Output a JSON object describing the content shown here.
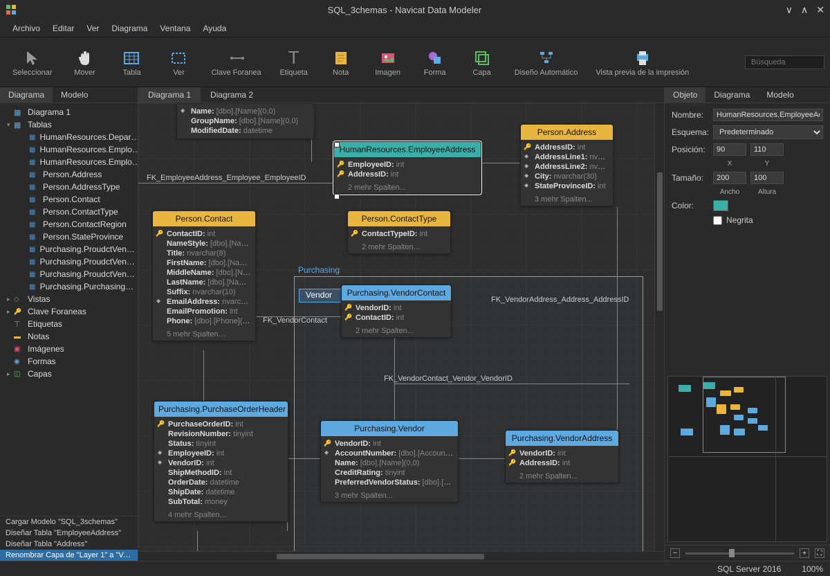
{
  "titlebar": {
    "title": "SQL_3chemas - Navicat Data Modeler"
  },
  "menubar": [
    "Archivo",
    "Editar",
    "Ver",
    "Diagrama",
    "Ventana",
    "Ayuda"
  ],
  "toolbar": {
    "items": [
      "Seleccionar",
      "Mover",
      "Tabla",
      "Ver",
      "Clave Foranea",
      "Etiqueta",
      "Nota",
      "Imagen",
      "Forma",
      "Capa",
      "Diseño Automático",
      "Vista previa de la impresión"
    ],
    "search_placeholder": "Búsqueda"
  },
  "left_tabs": {
    "diagrama": "Diagrama",
    "modelo": "Modelo"
  },
  "tree": {
    "diagram": "Diagrama 1",
    "tables_label": "Tablas",
    "tables": [
      "HumanResources.Depar…",
      "HumanResources.Emplo…",
      "HumanResources.Emplo…",
      "Person.Address",
      "Person.AddressType",
      "Person.Contact",
      "Person.ContactType",
      "Person.ContactRegion",
      "Person.StateProvince",
      "Purchasing.ProudctVen…",
      "Purchasing.ProudctVen…",
      "Purchasing.ProudctVen…",
      "Purchasing.Purchasing…"
    ],
    "vistas": "Vistas",
    "clave": "Clave Foraneas",
    "etiquetas": "Etiquetas",
    "notas": "Notas",
    "imagenes": "Imágenes",
    "formas": "Formas",
    "capas": "Capas"
  },
  "history": [
    "Cargar Modelo \"SQL_3schemas\"",
    "Diseñar Tabla \"EmployeeAddress\"",
    "Diseñar Tabla \"Address\"",
    "Renombrar Capa de \"Layer 1\" a \"Ve…"
  ],
  "canvas_tabs": [
    "Diagrama 1",
    "Diagrama 2"
  ],
  "layers": {
    "purchasing": "Purchasing",
    "vendor": "Vendor"
  },
  "fk_labels": {
    "emp": "FK_EmployeeAddress_Employee_EmployeeID",
    "vc": "FK_VendorContact",
    "vv": "FK_VendorContact_Vendor_VendorID",
    "va": "FK_VendorAddress_Address_AddressID"
  },
  "entities": {
    "empdept": {
      "title": "",
      "rows": [
        {
          "k": "di",
          "n": "Name:",
          "t": "[dbo].[Name](0,0)"
        },
        {
          "k": "",
          "n": "GroupName:",
          "t": "[dbo].[Name](0,0)"
        },
        {
          "k": "",
          "n": "ModifiedDate:",
          "t": "datetime"
        }
      ]
    },
    "empaddr": {
      "title": "HumanResources.EmployeeAddress",
      "rows": [
        {
          "k": "pk",
          "n": "EmployeeID:",
          "t": "int"
        },
        {
          "k": "pk",
          "n": "AddressID:",
          "t": "int"
        }
      ],
      "more": "2 mehr Spalten..."
    },
    "paddr": {
      "title": "Person.Address",
      "rows": [
        {
          "k": "pk",
          "n": "AddressID:",
          "t": "int"
        },
        {
          "k": "di",
          "n": "AddressLine1:",
          "t": "nvarchar(…"
        },
        {
          "k": "di",
          "n": "AddressLine2:",
          "t": "nvarchar(…"
        },
        {
          "k": "di",
          "n": "City:",
          "t": "nvarchar(30)"
        },
        {
          "k": "di",
          "n": "StateProvinceID:",
          "t": "int"
        }
      ],
      "more": "3 mehr Spalten..."
    },
    "pcontact": {
      "title": "Person.Contact",
      "rows": [
        {
          "k": "pk",
          "n": "ContactID:",
          "t": "int"
        },
        {
          "k": "",
          "n": "NameStyle:",
          "t": "[dbo].[NameSt…"
        },
        {
          "k": "",
          "n": "Title:",
          "t": "nvarchar(8)"
        },
        {
          "k": "",
          "n": "FirstName:",
          "t": "[dbo].[Name](0…"
        },
        {
          "k": "",
          "n": "MiddleName:",
          "t": "[dbo].[Name](…"
        },
        {
          "k": "",
          "n": "LastName:",
          "t": "[dbo].[Name](0,…"
        },
        {
          "k": "",
          "n": "Suffix:",
          "t": "nvarchar(10)"
        },
        {
          "k": "di",
          "n": "EmailAddress:",
          "t": "nvarchar(50)"
        },
        {
          "k": "",
          "n": "EmailPromotion:",
          "t": "int"
        },
        {
          "k": "",
          "n": "Phone:",
          "t": "[dbo].[Phone](0,0)"
        }
      ],
      "more": "5 mehr Spalten…"
    },
    "pctype": {
      "title": "Person.ContactType",
      "rows": [
        {
          "k": "pk",
          "n": "ContactTypeID:",
          "t": "int"
        }
      ],
      "more": "2 mehr Spalten..."
    },
    "pvc": {
      "title": "Purchasing.VendorContact",
      "rows": [
        {
          "k": "pk",
          "n": "VendorID:",
          "t": "int"
        },
        {
          "k": "pk",
          "n": "ContactID:",
          "t": "int"
        }
      ],
      "more": "2 mehr Spalten..."
    },
    "ppoh": {
      "title": "Purchasing.PurchaseOrderHeader",
      "rows": [
        {
          "k": "pk",
          "n": "PurchaseOrderID:",
          "t": "int"
        },
        {
          "k": "",
          "n": "RevisionNumber:",
          "t": "tinyint"
        },
        {
          "k": "",
          "n": "Status:",
          "t": "tinyint"
        },
        {
          "k": "di",
          "n": "EmployeeID:",
          "t": "int"
        },
        {
          "k": "di",
          "n": "VendorID:",
          "t": "int"
        },
        {
          "k": "",
          "n": "ShipMethodID:",
          "t": "int"
        },
        {
          "k": "",
          "n": "OrderDate:",
          "t": "datetime"
        },
        {
          "k": "",
          "n": "ShipDate:",
          "t": "datetime"
        },
        {
          "k": "",
          "n": "SubTotal:",
          "t": "money"
        }
      ],
      "more": "4 mehr Spalten..."
    },
    "pvendor": {
      "title": "Purchasing.Vendor",
      "rows": [
        {
          "k": "pk",
          "n": "VendorID:",
          "t": "int"
        },
        {
          "k": "di",
          "n": "AccountNumber:",
          "t": "[dbo].[AccountNumber](…"
        },
        {
          "k": "",
          "n": "Name:",
          "t": "[dbo].[Name](0,0)"
        },
        {
          "k": "",
          "n": "CreditRating:",
          "t": "tinyint"
        },
        {
          "k": "",
          "n": "PreferredVendorStatus:",
          "t": "[dbo].[Flag](0,0)"
        }
      ],
      "more": "3 mehr Spalten..."
    },
    "pva": {
      "title": "Purchasing.VendorAddress",
      "rows": [
        {
          "k": "pk",
          "n": "VendorID:",
          "t": "int"
        },
        {
          "k": "pk",
          "n": "AddressID:",
          "t": "int"
        }
      ],
      "more": "2 mehr Spalten..."
    }
  },
  "right_tabs": {
    "objeto": "Objeto",
    "diagrama": "Diagrama",
    "modelo": "Modelo"
  },
  "props": {
    "nombre_l": "Nombre:",
    "nombre": "HumanResources.EmployeeAddress",
    "esquema_l": "Esquema:",
    "esquema": "Predeterminado",
    "pos_l": "Posición:",
    "pos_x": "90",
    "pos_y": "110",
    "x_l": "X",
    "y_l": "Y",
    "tam_l": "Tamaño:",
    "tam_w": "200",
    "tam_h": "100",
    "w_l": "Ancho",
    "h_l": "Altura",
    "color_l": "Color:",
    "negrita": "Negrita"
  },
  "statusbar": {
    "db": "SQL Server 2016",
    "zoom": "100%"
  }
}
